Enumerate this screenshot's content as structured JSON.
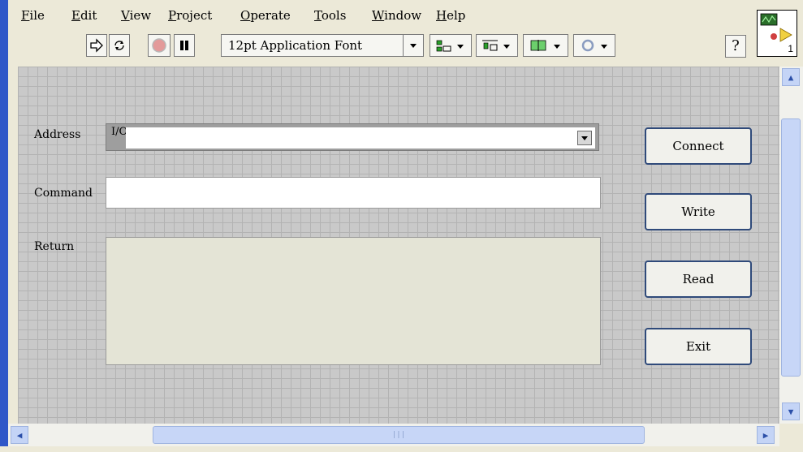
{
  "menu": {
    "items": [
      {
        "label": "File",
        "u": "F",
        "rest": "ile"
      },
      {
        "label": "Edit",
        "u": "E",
        "rest": "dit"
      },
      {
        "label": "View",
        "u": "V",
        "rest": "iew"
      },
      {
        "label": "Project",
        "u": "P",
        "rest": "roject"
      },
      {
        "label": "Operate",
        "u": "O",
        "rest": "perate"
      },
      {
        "label": "Tools",
        "u": "T",
        "rest": "ools"
      },
      {
        "label": "Window",
        "u": "W",
        "rest": "indow"
      },
      {
        "label": "Help",
        "u": "H",
        "rest": "elp"
      }
    ]
  },
  "toolbar": {
    "font_select": "12pt Application Font",
    "help_label": "?",
    "icons": [
      "run-arrow-icon",
      "run-continuously-icon",
      "abort-stop-icon",
      "pause-icon",
      "align-objects-icon",
      "distribute-objects-icon",
      "resize-objects-icon",
      "reorder-icon"
    ]
  },
  "vi_icon": {
    "number": "1"
  },
  "panel": {
    "address_label": "Address",
    "address_io_glyph": "I/O",
    "address_value": "",
    "command_label": "Command",
    "command_value": "",
    "return_label": "Return",
    "return_value": ""
  },
  "buttons": {
    "connect": "Connect",
    "write": "Write",
    "read": "Read",
    "exit": "Exit"
  },
  "colors": {
    "panel_bg": "#c9c9c9",
    "grid": "#b3b3b3",
    "frame_blue": "#2f57c8",
    "button_border": "#2f4a7a"
  }
}
